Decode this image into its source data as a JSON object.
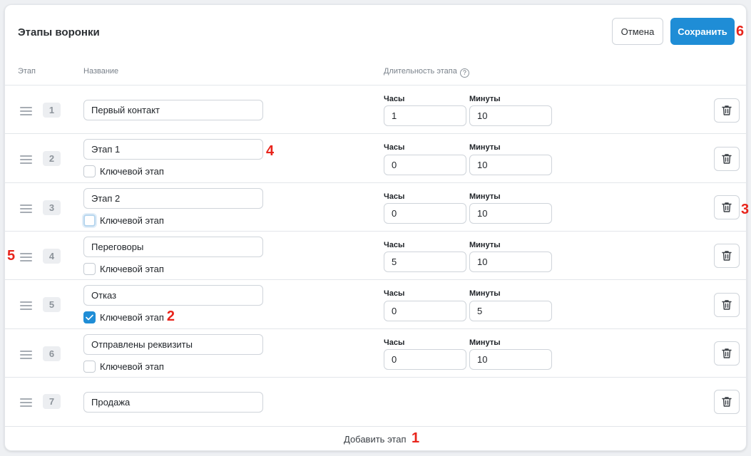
{
  "header": {
    "title": "Этапы воронки",
    "cancel_label": "Отмена",
    "save_label": "Сохранить"
  },
  "columns": {
    "stage": "Этап",
    "name": "Название",
    "duration": "Длительность этапа",
    "help_icon": "?"
  },
  "labels": {
    "hours": "Часы",
    "minutes": "Минуты",
    "key_stage": "Ключевой этап"
  },
  "stages": [
    {
      "number": "1",
      "name": "Первый контакт",
      "hours": "1",
      "minutes": "10",
      "key_stage": null
    },
    {
      "number": "2",
      "name": "Этап 1",
      "hours": "0",
      "minutes": "10",
      "key_stage": false
    },
    {
      "number": "3",
      "name": "Этап 2",
      "hours": "0",
      "minutes": "10",
      "key_stage": false
    },
    {
      "number": "4",
      "name": "Переговоры",
      "hours": "5",
      "minutes": "10",
      "key_stage": false
    },
    {
      "number": "5",
      "name": "Отказ",
      "hours": "0",
      "minutes": "5",
      "key_stage": true
    },
    {
      "number": "6",
      "name": "Отправлены реквизиты",
      "hours": "0",
      "minutes": "10",
      "key_stage": false
    },
    {
      "number": "7",
      "name": "Продажа",
      "hours": null,
      "minutes": null,
      "key_stage": null
    }
  ],
  "footer": {
    "add_label": "Добавить этап"
  },
  "markers": [
    "1",
    "2",
    "3",
    "4",
    "5",
    "6"
  ],
  "colors": {
    "accent": "#1f8dd6",
    "marker": "#e8241b"
  },
  "icons": {
    "drag": "drag-handle-icon",
    "trash": "trash-icon",
    "check": "check-icon",
    "help": "question-circle-icon"
  }
}
